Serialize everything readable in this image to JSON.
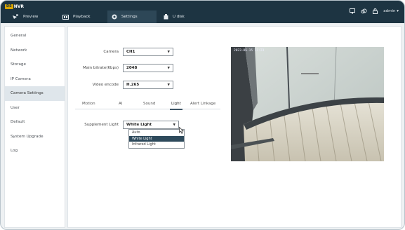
{
  "app": {
    "logo_badge": "DS",
    "logo_text": "NVR"
  },
  "nav_tabs": [
    {
      "label": "Preview",
      "icon": "camera-icon",
      "active": false
    },
    {
      "label": "Playback",
      "icon": "playback-icon",
      "active": false
    },
    {
      "label": "Settings",
      "icon": "gear-icon",
      "active": true
    },
    {
      "label": "U disk",
      "icon": "usb-disk-icon",
      "active": false
    }
  ],
  "top_right": {
    "user_label": "admin",
    "icons": [
      "monitor-icon",
      "cloud-icon",
      "lock-icon"
    ]
  },
  "sidebar": {
    "items": [
      {
        "label": "General",
        "active": false
      },
      {
        "label": "Network",
        "active": false
      },
      {
        "label": "Storage",
        "active": false
      },
      {
        "label": "IP Camera",
        "active": false
      },
      {
        "label": "Camera Settings",
        "active": true
      },
      {
        "label": "User",
        "active": false
      },
      {
        "label": "Default",
        "active": false
      },
      {
        "label": "System Upgrade",
        "active": false
      },
      {
        "label": "Log",
        "active": false
      }
    ]
  },
  "form": {
    "camera": {
      "label": "Camera",
      "value": "CH1"
    },
    "bitrate": {
      "label": "Main bitrate(Kbps)",
      "value": "2048"
    },
    "encode": {
      "label": "Video encode",
      "value": "H.265"
    }
  },
  "subtabs": [
    {
      "label": "Motion",
      "active": false
    },
    {
      "label": "AI",
      "active": false
    },
    {
      "label": "Sound",
      "active": false
    },
    {
      "label": "Light",
      "active": true
    },
    {
      "label": "Alert Linkage",
      "active": false
    }
  ],
  "supplement_light": {
    "label": "Supplement Light",
    "value": "White Light",
    "options": [
      {
        "label": "Auto",
        "selected": false
      },
      {
        "label": "White Light",
        "selected": true
      },
      {
        "label": "Infrared Light",
        "selected": false
      }
    ]
  },
  "preview": {
    "osd_text": "2023-06-15 11:23"
  },
  "colors": {
    "topbar": "#1d3442",
    "accent": "#2e4a5c",
    "logo_badge": "#d8a400"
  }
}
